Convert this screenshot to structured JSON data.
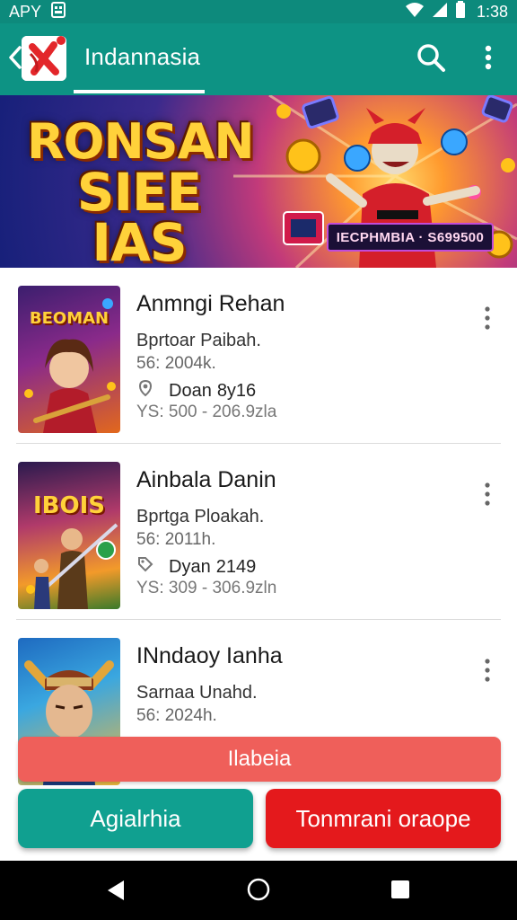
{
  "status_bar": {
    "carrier": "APY",
    "time": "1:38",
    "icons": [
      "sim-icon",
      "wifi-icon",
      "signal-icon",
      "battery-icon"
    ]
  },
  "app_bar": {
    "title": "Indannasia",
    "icons": [
      "back-chevron-icon",
      "app-logo",
      "search-icon",
      "more-vert-icon"
    ]
  },
  "banner": {
    "title_line1": "RONSAN",
    "title_line2": "SIEE IAS",
    "tag": "IECPHMBIA · S699500"
  },
  "items": [
    {
      "title": "Anmngi Rehan",
      "subtitle": "Bprtoar Paibah.",
      "meta1": "56: 2004k.",
      "meta2_label": "Doan",
      "meta2_value": "8y16",
      "meta3": "YS: 500 - 206.9zla",
      "thumb_text": "BEOMAN"
    },
    {
      "title": "Ainbala Danin",
      "subtitle": "Bprtga Ploakah.",
      "meta1": "56: 2011h.",
      "meta2_label": "Dyan",
      "meta2_value": "2149",
      "meta3": "YS: 309 - 306.9zln",
      "thumb_text": "IBOIS"
    },
    {
      "title": "INndaoy Ianha",
      "subtitle": "Sarnaa Unahd.",
      "meta1": "56: 2024h.",
      "meta2_label": "",
      "meta2_value": "",
      "meta3": "",
      "thumb_text": ""
    }
  ],
  "buttons": {
    "bar": "Ilabeia",
    "green": "Agialrhia",
    "red": "Tonmrani oraope"
  },
  "colors": {
    "primary": "#0d9384",
    "status_bar": "#0d8a7c",
    "button_green": "#10a090",
    "button_red": "#e4191c",
    "button_bar": "#ef5f5a"
  }
}
